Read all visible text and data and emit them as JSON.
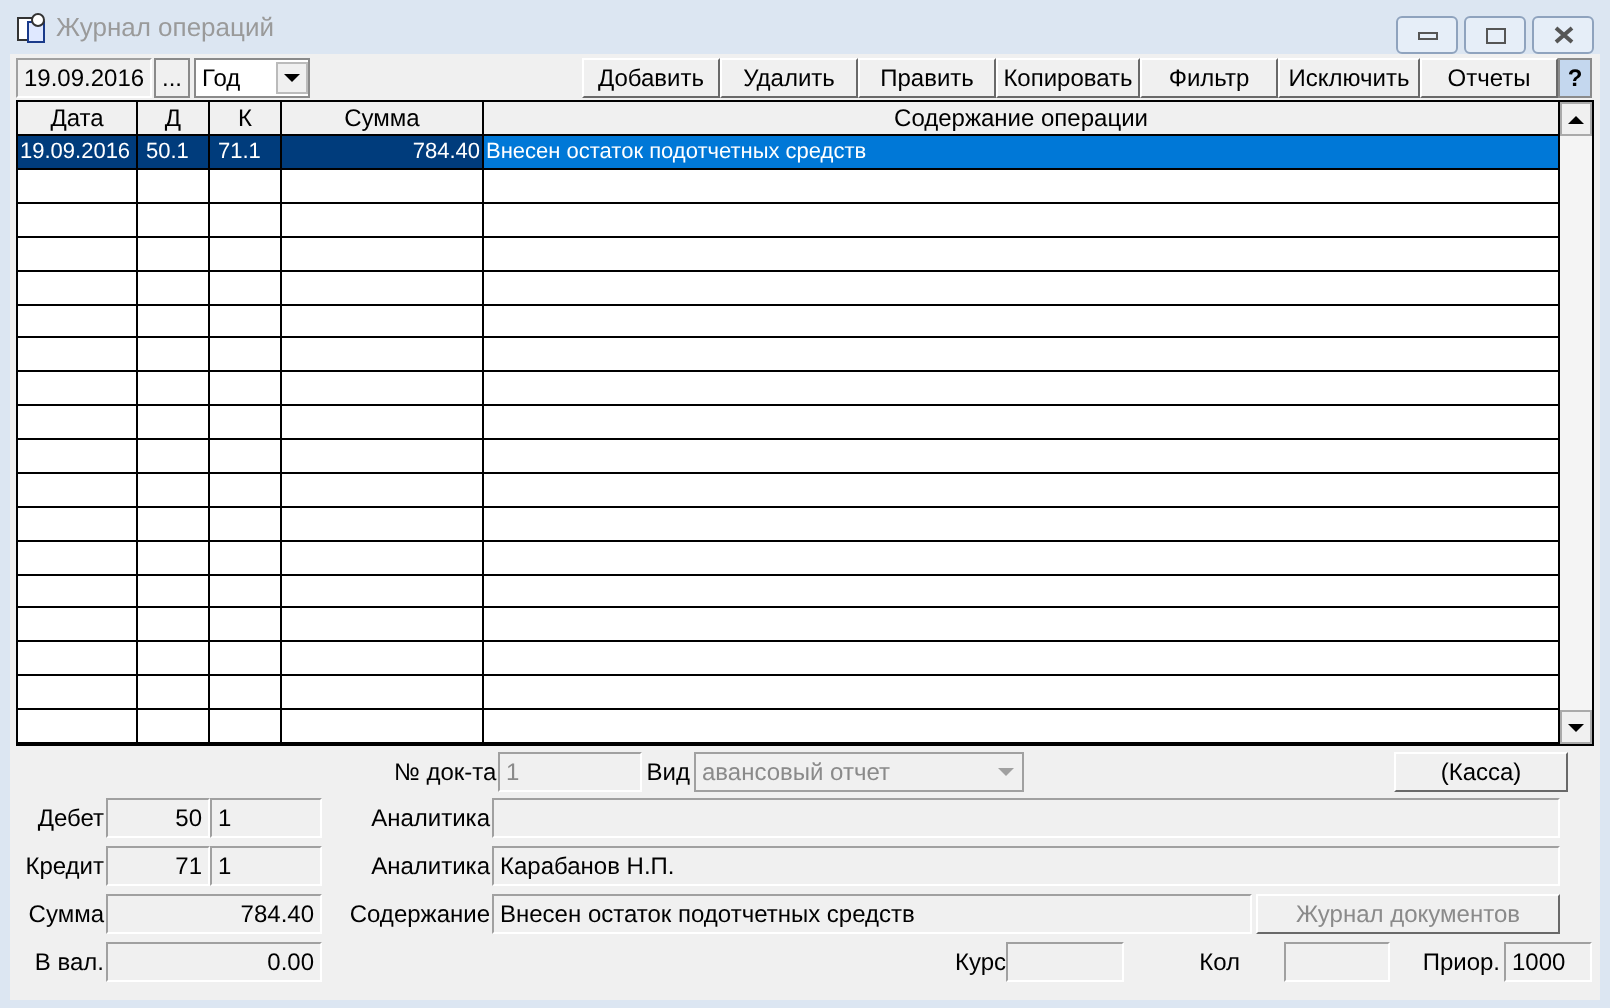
{
  "window": {
    "title": "Журнал операций"
  },
  "toolbar": {
    "date": "19.09.2016",
    "date_picker_button": "...",
    "period": "Год",
    "buttons": [
      "Добавить",
      "Удалить",
      "Править",
      "Копировать",
      "Фильтр",
      "Исключить",
      "Отчеты"
    ],
    "help_button": "?"
  },
  "table": {
    "columns": [
      "Дата",
      "Д",
      "К",
      "Сумма",
      "Содержание операции"
    ],
    "rows": [
      {
        "cells": [
          "19.09.2016",
          "50.1",
          "71.1",
          "784.40",
          "Внесен остаток подотчетных средств"
        ],
        "selected": true
      }
    ]
  },
  "form": {
    "doc_number": {
      "label": "№ док-та",
      "value": "1",
      "disabled": true
    },
    "doc_type": {
      "label": "Вид",
      "value": "авансовый отчет",
      "disabled": true
    },
    "cash_button": "(Касса)",
    "debit": {
      "label": "Дебет",
      "account": "50",
      "sub": "1"
    },
    "credit": {
      "label": "Кредит",
      "account": "71",
      "sub": "1"
    },
    "analytics": [
      {
        "label": "Аналитика"
      },
      {
        "label": "Аналитика",
        "value": "Карабанов Н.П."
      }
    ],
    "sum": {
      "label": "Сумма",
      "value": "784.40"
    },
    "content": {
      "label": "Содержание",
      "value": "Внесен остаток подотчетных средств"
    },
    "journal_button": {
      "label": "Журнал документов",
      "disabled": true
    },
    "currency": {
      "label": "В вал.",
      "value": "0.00"
    },
    "rate": {
      "label": "Курс"
    },
    "quantity": {
      "label": "Кол"
    },
    "priority": {
      "label": "Приор.",
      "value": "1000"
    }
  }
}
